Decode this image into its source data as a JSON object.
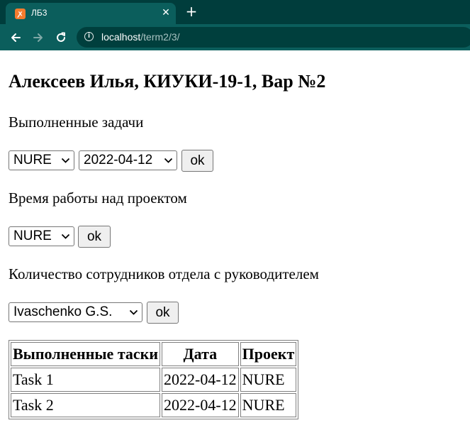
{
  "browser": {
    "tab": {
      "title": "ЛБ3",
      "favicon": "xampp-icon",
      "favicon_glyph": "ꭗ"
    },
    "close_glyph": "✕",
    "new_tab_glyph": "+",
    "address": {
      "host": "localhost",
      "path": "/term2/3/"
    },
    "colors": {
      "titlebar": "#003d3c",
      "toolbar": "#0b5e5c",
      "omnibox": "#003f3d"
    }
  },
  "page": {
    "heading": "Алексеев Илья, КИУКИ-19-1, Вар №2",
    "sections": [
      {
        "label": "Выполненные задачи",
        "selects": [
          {
            "name": "project-select",
            "value": "NURE"
          },
          {
            "name": "date-select",
            "value": "2022-04-12"
          }
        ],
        "button": "ok"
      },
      {
        "label": "Время работы над проектом",
        "selects": [
          {
            "name": "project-select",
            "value": "NURE"
          }
        ],
        "button": "ok"
      },
      {
        "label": "Количество сотрудников отдела с руководителем",
        "selects": [
          {
            "name": "manager-select",
            "value": "Ivaschenko G.S."
          }
        ],
        "button": "ok"
      }
    ],
    "table": {
      "headers": [
        "Выполненные таски",
        "Дата",
        "Проект"
      ],
      "rows": [
        [
          "Task 1",
          "2022-04-12",
          "NURE"
        ],
        [
          "Task 2",
          "2022-04-12",
          "NURE"
        ]
      ]
    }
  }
}
